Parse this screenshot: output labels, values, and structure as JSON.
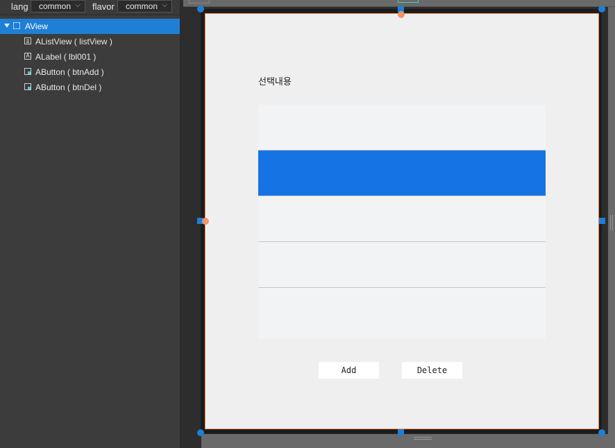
{
  "toolbar": {
    "lang_label": "lang",
    "lang_value": "common",
    "flavor_label": "flavor",
    "flavor_value": "common"
  },
  "tree": {
    "items": [
      {
        "label": "AView",
        "icon": "view-icon",
        "selected": true,
        "expanded": true
      },
      {
        "label": "AListView ( listView )",
        "icon": "listview-icon"
      },
      {
        "label": "ALabel ( lbl001 )",
        "icon": "label-icon",
        "icon_glyph": "A"
      },
      {
        "label": "AButton ( btnAdd )",
        "icon": "button-icon"
      },
      {
        "label": "AButton ( btnDel )",
        "icon": "button-icon"
      }
    ]
  },
  "canvas": {
    "label_text": "선택내용",
    "list_items": [
      {
        "selected": false
      },
      {
        "selected": true
      },
      {
        "selected": false
      },
      {
        "selected": false
      },
      {
        "selected": false
      }
    ],
    "add_button": "Add",
    "delete_button": "Delete"
  },
  "colors": {
    "selection_blue": "#1673e4",
    "tree_selected": "#1f7fd6",
    "handle_blue": "#1f7fd6",
    "device_border": "#f08a4b"
  }
}
